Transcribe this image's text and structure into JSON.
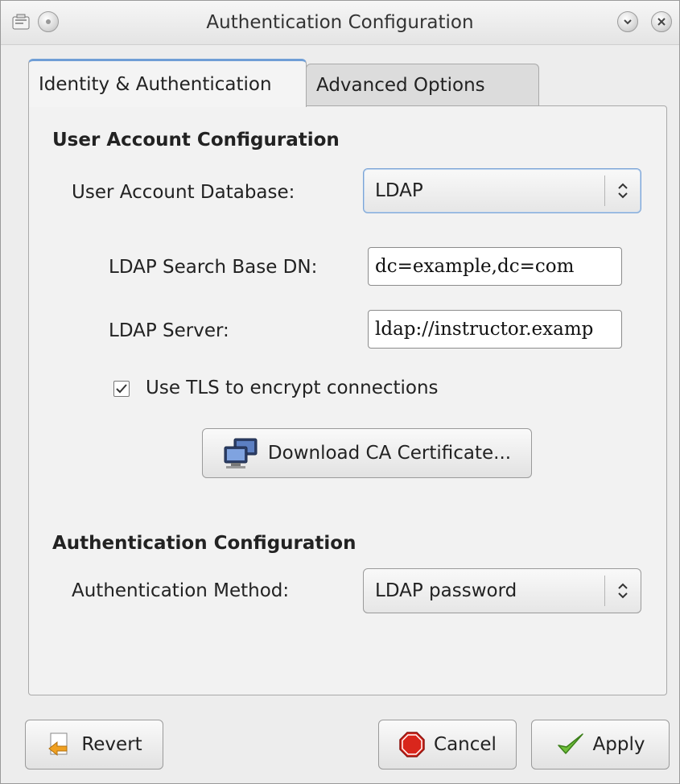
{
  "window": {
    "title": "Authentication Configuration"
  },
  "tabs": [
    {
      "label": "Identity & Authentication",
      "active": true
    },
    {
      "label": "Advanced Options",
      "active": false
    }
  ],
  "user_account": {
    "section_title": "User Account Configuration",
    "database_label": "User Account Database:",
    "database_value": "LDAP",
    "search_base_label": "LDAP Search Base DN:",
    "search_base_value": "dc=example,dc=com",
    "server_label": "LDAP Server:",
    "server_value": "ldap://instructor.examp",
    "tls_label": "Use TLS to encrypt connections",
    "tls_checked": true,
    "download_ca_label": "Download CA Certificate..."
  },
  "authentication": {
    "section_title": "Authentication Configuration",
    "method_label": "Authentication Method:",
    "method_value": "LDAP password"
  },
  "buttons": {
    "revert": "Revert",
    "cancel": "Cancel",
    "apply": "Apply"
  },
  "colors": {
    "tab_accent": "#6f9ed6",
    "cancel_red": "#d9261c",
    "apply_green": "#6fbf3a",
    "revert_orange": "#f0a020"
  }
}
